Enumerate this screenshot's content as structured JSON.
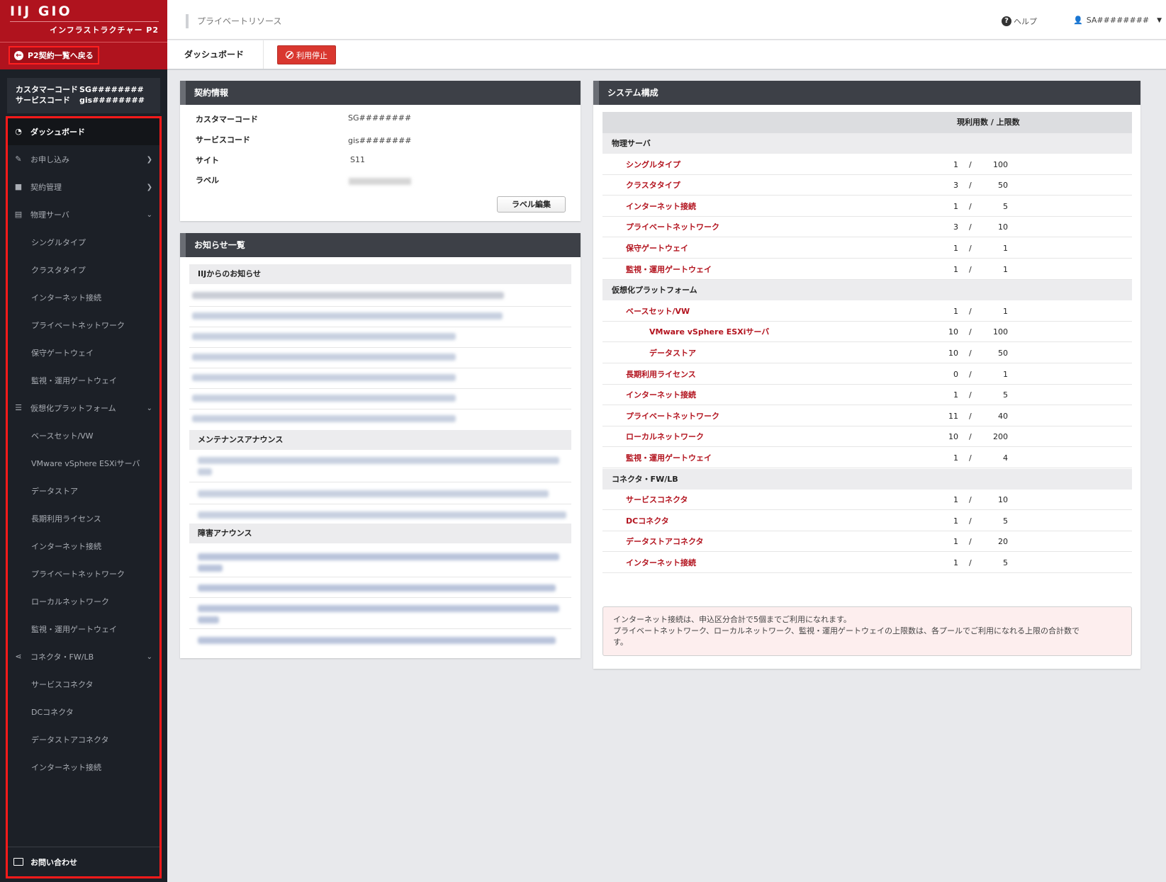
{
  "logo": {
    "main": "IIJ GIO",
    "sub": "インフラストラクチャー P2"
  },
  "back_label": "P2契約一覧へ戻る",
  "codes": {
    "customer_label": "カスタマーコード",
    "customer_value": "SG########",
    "service_label": "サービスコード",
    "service_value": "gis########"
  },
  "nav": {
    "items": [
      {
        "label": "ダッシュボード",
        "icon": "dashboard-icon"
      },
      {
        "label": "お申し込み",
        "icon": "edit-icon"
      },
      {
        "label": "契約管理",
        "icon": "truck-icon"
      },
      {
        "label": "物理サーバ",
        "icon": "server-icon"
      },
      {
        "label": "シングルタイプ"
      },
      {
        "label": "クラスタタイプ"
      },
      {
        "label": "インターネット接続"
      },
      {
        "label": "プライベートネットワーク"
      },
      {
        "label": "保守ゲートウェイ"
      },
      {
        "label": "監視・運用ゲートウェイ"
      },
      {
        "label": "仮想化プラットフォーム",
        "icon": "list-icon"
      },
      {
        "label": "ベースセット/VW"
      },
      {
        "label": "VMware vSphere ESXiサーバ"
      },
      {
        "label": "データストア"
      },
      {
        "label": "長期利用ライセンス"
      },
      {
        "label": "インターネット接続"
      },
      {
        "label": "プライベートネットワーク"
      },
      {
        "label": "ローカルネットワーク"
      },
      {
        "label": "監視・運用ゲートウェイ"
      },
      {
        "label": "コネクタ・FW/LB",
        "icon": "share-icon"
      },
      {
        "label": "サービスコネクタ"
      },
      {
        "label": "DCコネクタ"
      },
      {
        "label": "データストアコネクタ"
      },
      {
        "label": "インターネット接続"
      }
    ],
    "contact": "お問い合わせ"
  },
  "header": {
    "breadcrumb": "プライベートリソース",
    "help": "ヘルプ",
    "user": "SA########"
  },
  "tabs": {
    "dashboard": "ダッシュボード",
    "stop": "利用停止"
  },
  "contract": {
    "title": "契約情報",
    "rows": [
      {
        "label": "カスタマーコード",
        "value": "SG########"
      },
      {
        "label": "サービスコード",
        "value": "gis########"
      },
      {
        "label": "サイト",
        "value": "S11"
      },
      {
        "label": "ラベル",
        "value": ""
      }
    ],
    "edit_label": "ラベル編集"
  },
  "news": {
    "title": "お知らせ一覧",
    "sections": [
      "IIJからのお知らせ",
      "メンテナンスアナウンス",
      "障害アナウンス"
    ]
  },
  "system": {
    "title": "システム構成",
    "header": "現利用数 / 上限数",
    "groups": [
      {
        "name": "物理サーバ",
        "rows": [
          {
            "name": "シングルタイプ",
            "used": "1",
            "limit": "100"
          },
          {
            "name": "クラスタタイプ",
            "used": "3",
            "limit": "50"
          },
          {
            "name": "インターネット接続",
            "used": "1",
            "limit": "5"
          },
          {
            "name": "プライベートネットワーク",
            "used": "3",
            "limit": "10"
          },
          {
            "name": "保守ゲートウェイ",
            "used": "1",
            "limit": "1"
          },
          {
            "name": "監視・運用ゲートウェイ",
            "used": "1",
            "limit": "1"
          }
        ]
      },
      {
        "name": "仮想化プラットフォーム",
        "rows": [
          {
            "name": "ベースセット/VW",
            "used": "1",
            "limit": "1"
          },
          {
            "name": "VMware vSphere ESXiサーバ",
            "used": "10",
            "limit": "100",
            "indent": true
          },
          {
            "name": "データストア",
            "used": "10",
            "limit": "50",
            "indent": true
          },
          {
            "name": "長期利用ライセンス",
            "used": "0",
            "limit": "1"
          },
          {
            "name": "インターネット接続",
            "used": "1",
            "limit": "5"
          },
          {
            "name": "プライベートネットワーク",
            "used": "11",
            "limit": "40"
          },
          {
            "name": "ローカルネットワーク",
            "used": "10",
            "limit": "200"
          },
          {
            "name": "監視・運用ゲートウェイ",
            "used": "1",
            "limit": "4"
          }
        ]
      },
      {
        "name": "コネクタ・FW/LB",
        "rows": [
          {
            "name": "サービスコネクタ",
            "used": "1",
            "limit": "10"
          },
          {
            "name": "DCコネクタ",
            "used": "1",
            "limit": "5"
          },
          {
            "name": "データストアコネクタ",
            "used": "1",
            "limit": "20"
          },
          {
            "name": "インターネット接続",
            "used": "1",
            "limit": "5"
          }
        ]
      }
    ],
    "note_lines": [
      "インターネット接続は、申込区分合計で5個までご利用になれます。",
      "プライベートネットワーク、ローカルネットワーク、監視・運用ゲートウェイの上限数は、各プールでご利用になれる上限の合計数で",
      "す。"
    ]
  },
  "colors": {
    "brand_red": "#b0131e",
    "sidebar_bg": "#1c2027",
    "highlight": "#ff1a1a",
    "link_red": "#b3141f"
  }
}
